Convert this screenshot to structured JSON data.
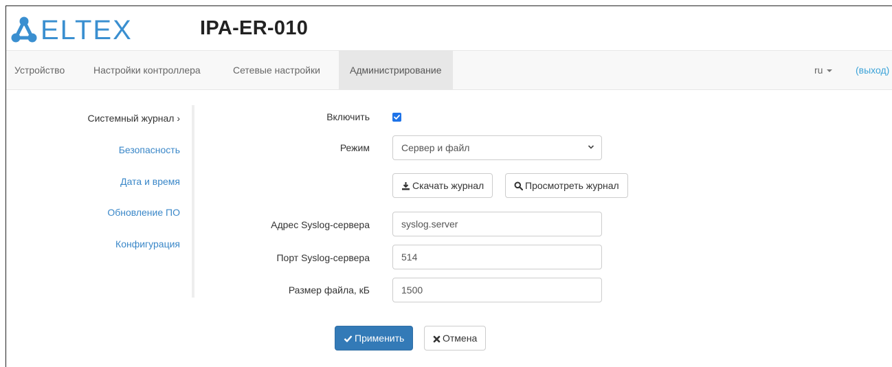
{
  "brand": {
    "logo_text": "ELTEX",
    "model": "IPA-ER-010",
    "logo_color": "#3a8fd0"
  },
  "nav": {
    "items": [
      "Устройство",
      "Настройки контроллера",
      "Сетевые настройки",
      "Администрирование"
    ],
    "active_index": 3,
    "lang": "ru",
    "logout": "(выход)"
  },
  "sidebar": {
    "items": [
      "Системный журнал ›",
      "Безопасность",
      "Дата и время",
      "Обновление ПО",
      "Конфигурация"
    ],
    "active_index": 0
  },
  "form": {
    "enable_label": "Включить",
    "enable_checked": true,
    "mode_label": "Режим",
    "mode_value": "Сервер и файл",
    "download_button": "Скачать журнал",
    "view_button": "Просмотреть журнал",
    "server_label": "Адрес Syslog-сервера",
    "server_value": "syslog.server",
    "port_label": "Порт Syslog-сервера",
    "port_value": "514",
    "size_label": "Размер файла, кБ",
    "size_value": "1500",
    "apply_button": "Применить",
    "cancel_button": "Отмена"
  },
  "colors": {
    "primary": "#337ab7",
    "link": "#3a87c8",
    "checkbox": "#1e73e8"
  }
}
